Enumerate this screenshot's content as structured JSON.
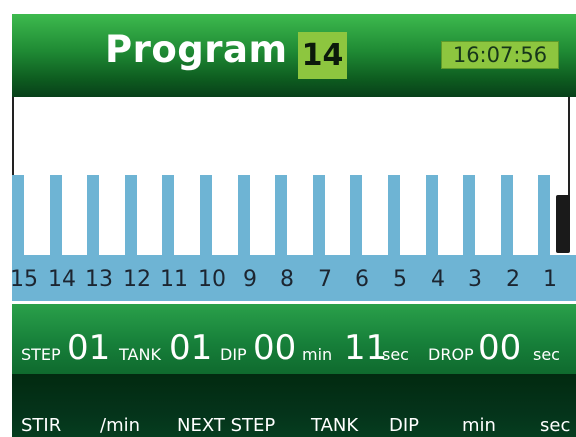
{
  "header": {
    "title": "Program",
    "program_number": "14",
    "time": "16:07:56"
  },
  "tanks": {
    "labels": [
      "15",
      "14",
      "13",
      "12",
      "11",
      "10",
      "9",
      "8",
      "7",
      "6",
      "5",
      "4",
      "3",
      "2",
      "1"
    ],
    "active_tank": "1"
  },
  "status": {
    "step_label": "STEP",
    "step_value": "01",
    "tank_label": "TANK",
    "tank_value": "01",
    "dip_label": "DIP",
    "dip_min_value": "00",
    "min_unit": "min",
    "dip_sec_value": "11",
    "sec_unit": "sec",
    "drop_label": "DROP",
    "drop_value": "00",
    "drop_unit": "sec"
  },
  "buttons": {
    "stir": "STIR",
    "per_min": "/min",
    "next_step": "NEXT STEP",
    "tank": "TANK",
    "dip": "DIP",
    "min": "min",
    "sec": "sec"
  },
  "colors": {
    "header_green": "#1f8a34",
    "accent_lime": "#8dc63f",
    "tank_blue": "#6eb4d4",
    "status_green": "#17803a",
    "footer_dark": "#04331a"
  }
}
